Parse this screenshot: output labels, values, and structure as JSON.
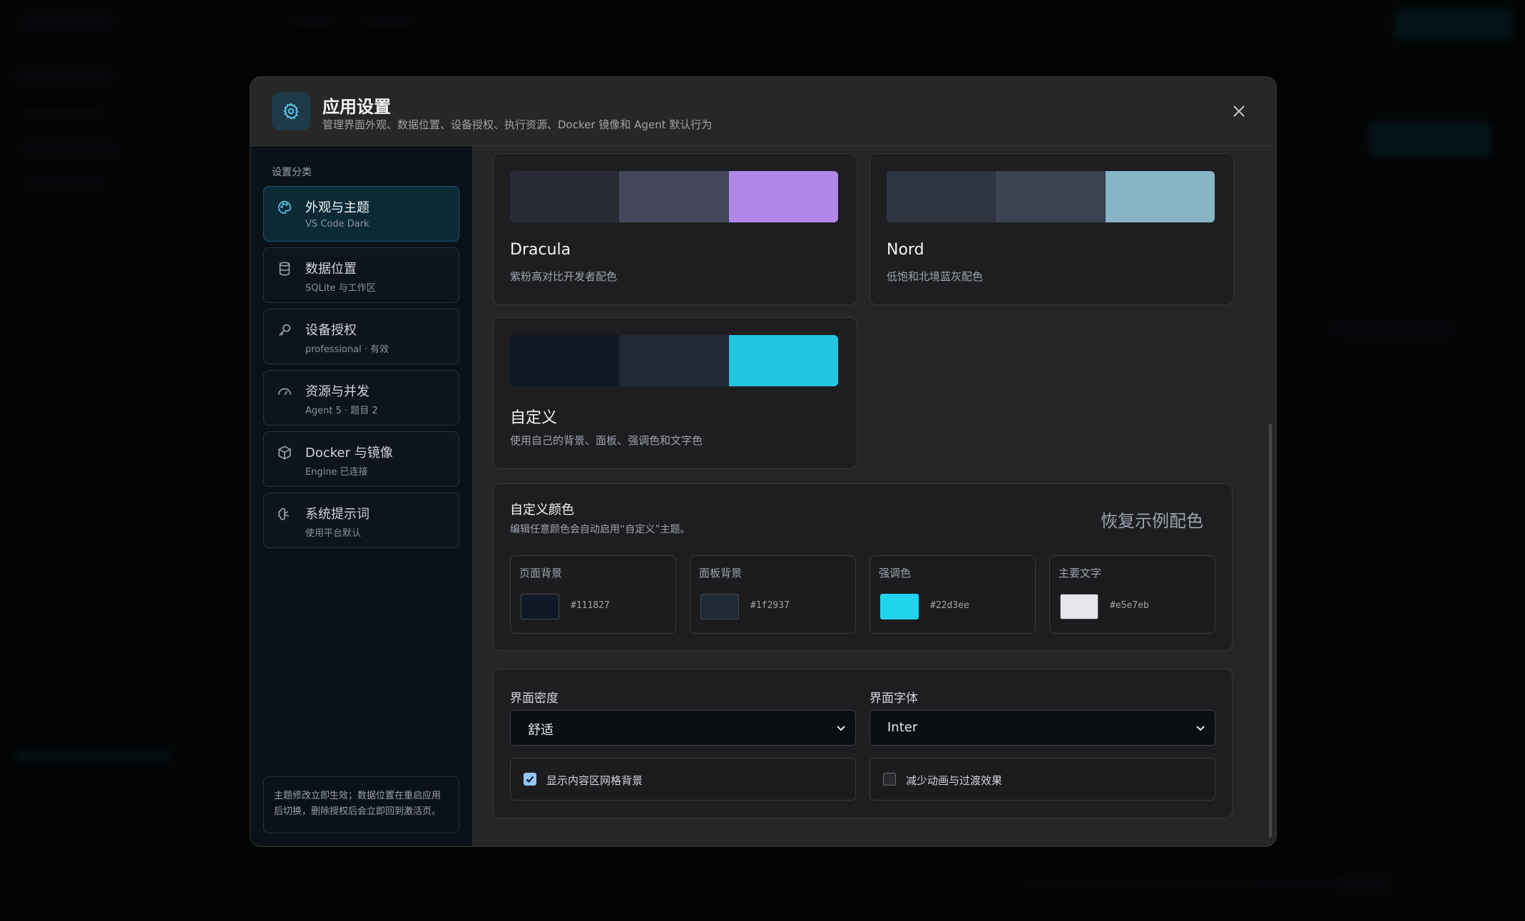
{
  "dialog": {
    "title": "应用设置",
    "subtitle": "管理界面外观、数据位置、设备授权、执行资源、Docker 镜像和 Agent 默认行为"
  },
  "sidebar": {
    "heading": "设置分类",
    "items": [
      {
        "label": "外观与主题",
        "sub": "VS Code Dark",
        "icon": "palette-icon"
      },
      {
        "label": "数据位置",
        "sub": "SQLite 与工作区",
        "icon": "database-icon"
      },
      {
        "label": "设备授权",
        "sub": "professional · 有效",
        "icon": "key-icon"
      },
      {
        "label": "资源与并发",
        "sub": "Agent 5 · 题目 2",
        "icon": "gauge-icon"
      },
      {
        "label": "Docker 与镜像",
        "sub": "Engine 已连接",
        "icon": "box-icon"
      },
      {
        "label": "系统提示词",
        "sub": "使用平台默认",
        "icon": "brain-icon"
      }
    ],
    "note": "主题修改立即生效；数据位置在重启应用后切换，删除授权后会立即回到激活页。"
  },
  "themes": [
    {
      "name": "Dracula",
      "desc": "紫粉高对比开发者配色",
      "colors": [
        "#282a36",
        "#44475a",
        "#b088e8"
      ]
    },
    {
      "name": "Nord",
      "desc": "低饱和北境蓝灰配色",
      "colors": [
        "#2e3440",
        "#3b4252",
        "#88b5c5"
      ]
    },
    {
      "name": "自定义",
      "desc": "使用自己的背景、面板、强调色和文字色",
      "colors": [
        "#111827",
        "#1f2937",
        "#22c4e0"
      ]
    }
  ],
  "custom_colors": {
    "title": "自定义颜色",
    "desc": "编辑任意颜色会自动启用“自定义”主题。",
    "restore_label": "恢复示例配色",
    "items": [
      {
        "label": "页面背景",
        "hex": "#111827"
      },
      {
        "label": "面板背景",
        "hex": "#1f2937"
      },
      {
        "label": "强调色",
        "hex": "#22d3ee"
      },
      {
        "label": "主要文字",
        "hex": "#e5e7eb"
      }
    ]
  },
  "ui_options": {
    "density_label": "界面密度",
    "density_value": "舒适",
    "font_label": "界面字体",
    "font_value": "Inter",
    "grid_label": "显示内容区网格背景",
    "grid_checked": true,
    "motion_label": "减少动画与过渡效果",
    "motion_checked": false
  }
}
